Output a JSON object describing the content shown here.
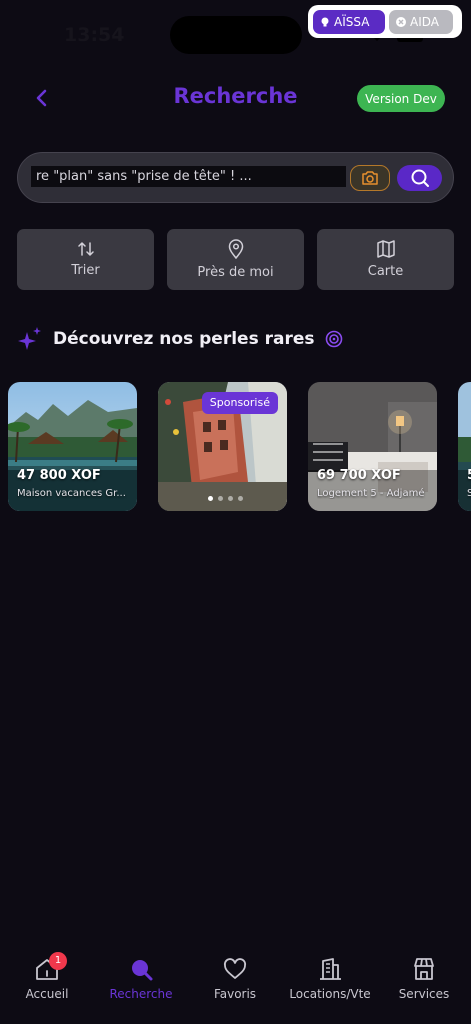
{
  "status_bar": {
    "time": "13:54"
  },
  "dev_switch": {
    "active_user": "AÏSSA",
    "other_user": "AIDA"
  },
  "header": {
    "title": "Recherche",
    "version_badge": "Version Dev"
  },
  "search": {
    "query": "re \"plan\" sans \"prise de tête\" ! ..."
  },
  "actions": [
    {
      "label": "Trier",
      "icon": "sort-arrows-icon"
    },
    {
      "label": "Près de moi",
      "icon": "location-pin-icon"
    },
    {
      "label": "Carte",
      "icon": "map-icon"
    }
  ],
  "section": {
    "title": "Découvrez nos perles rares"
  },
  "listings": [
    {
      "price": "47 800 XOF",
      "name": "Maison vacances Gr..."
    },
    {
      "badge": "Sponsorisé",
      "photo_count": 4,
      "active_photo": 1
    },
    {
      "price": "69 700 XOF",
      "name": "Logement 5 - Adjamé"
    },
    {
      "price": "5",
      "name": "S"
    }
  ],
  "nav": {
    "home": "Accueil",
    "home_badge": "1",
    "search": "Recherche",
    "favorites": "Favoris",
    "rentals": "Locations/Vte",
    "services": "Services"
  },
  "colors": {
    "accent": "#6a35d6",
    "dev_green": "#3db552",
    "background": "#0d0b14",
    "badge_red": "#f0384c"
  }
}
